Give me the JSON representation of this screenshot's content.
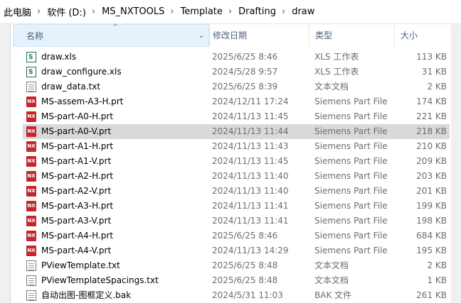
{
  "breadcrumb": [
    "此电脑",
    "软件 (D:)",
    "MS_NXTOOLS",
    "Template",
    "Drafting",
    "draw"
  ],
  "columns": {
    "name": "名称",
    "date": "修改日期",
    "type": "类型",
    "size": "大小"
  },
  "files": [
    {
      "name": "draw.xls",
      "date": "2025/6/25 8:46",
      "type": "XLS 工作表",
      "size": "113 KB",
      "icon": "xls-icon"
    },
    {
      "name": "draw_configure.xls",
      "date": "2024/5/28 9:57",
      "type": "XLS 工作表",
      "size": "31 KB",
      "icon": "xls-icon"
    },
    {
      "name": "draw_data.txt",
      "date": "2025/6/25 8:39",
      "type": "文本文档",
      "size": "2 KB",
      "icon": "txt-icon"
    },
    {
      "name": "MS-assem-A3-H.prt",
      "date": "2024/12/11 17:24",
      "type": "Siemens Part File",
      "size": "174 KB",
      "icon": "nx-icon"
    },
    {
      "name": "MS-part-A0-H.prt",
      "date": "2024/11/13 11:45",
      "type": "Siemens Part File",
      "size": "221 KB",
      "icon": "nx-icon"
    },
    {
      "name": "MS-part-A0-V.prt",
      "date": "2024/11/13 11:44",
      "type": "Siemens Part File",
      "size": "218 KB",
      "icon": "nx-icon"
    },
    {
      "name": "MS-part-A1-H.prt",
      "date": "2024/11/13 11:43",
      "type": "Siemens Part File",
      "size": "210 KB",
      "icon": "nx-icon"
    },
    {
      "name": "MS-part-A1-V.prt",
      "date": "2024/11/13 11:45",
      "type": "Siemens Part File",
      "size": "209 KB",
      "icon": "nx-icon"
    },
    {
      "name": "MS-part-A2-H.prt",
      "date": "2024/11/13 11:40",
      "type": "Siemens Part File",
      "size": "203 KB",
      "icon": "nx-icon"
    },
    {
      "name": "MS-part-A2-V.prt",
      "date": "2024/11/13 11:40",
      "type": "Siemens Part File",
      "size": "201 KB",
      "icon": "nx-icon"
    },
    {
      "name": "MS-part-A3-H.prt",
      "date": "2024/11/13 11:41",
      "type": "Siemens Part File",
      "size": "199 KB",
      "icon": "nx-icon"
    },
    {
      "name": "MS-part-A3-V.prt",
      "date": "2024/11/13 11:41",
      "type": "Siemens Part File",
      "size": "198 KB",
      "icon": "nx-icon"
    },
    {
      "name": "MS-part-A4-H.prt",
      "date": "2025/6/25 8:46",
      "type": "Siemens Part File",
      "size": "684 KB",
      "icon": "nx-icon"
    },
    {
      "name": "MS-part-A4-V.prt",
      "date": "2024/11/13 14:29",
      "type": "Siemens Part File",
      "size": "195 KB",
      "icon": "nx-icon"
    },
    {
      "name": "PViewTemplate.txt",
      "date": "2025/6/25 8:48",
      "type": "文本文档",
      "size": "2 KB",
      "icon": "txt-icon"
    },
    {
      "name": "PViewTemplateSpacings.txt",
      "date": "2025/6/25 8:48",
      "type": "文本文档",
      "size": "1 KB",
      "icon": "txt-icon"
    },
    {
      "name": "自动出图-图框定义.bak",
      "date": "2024/5/31 11:03",
      "type": "BAK 文件",
      "size": "261 KB",
      "icon": "txt-icon"
    }
  ],
  "selected_index": 5
}
